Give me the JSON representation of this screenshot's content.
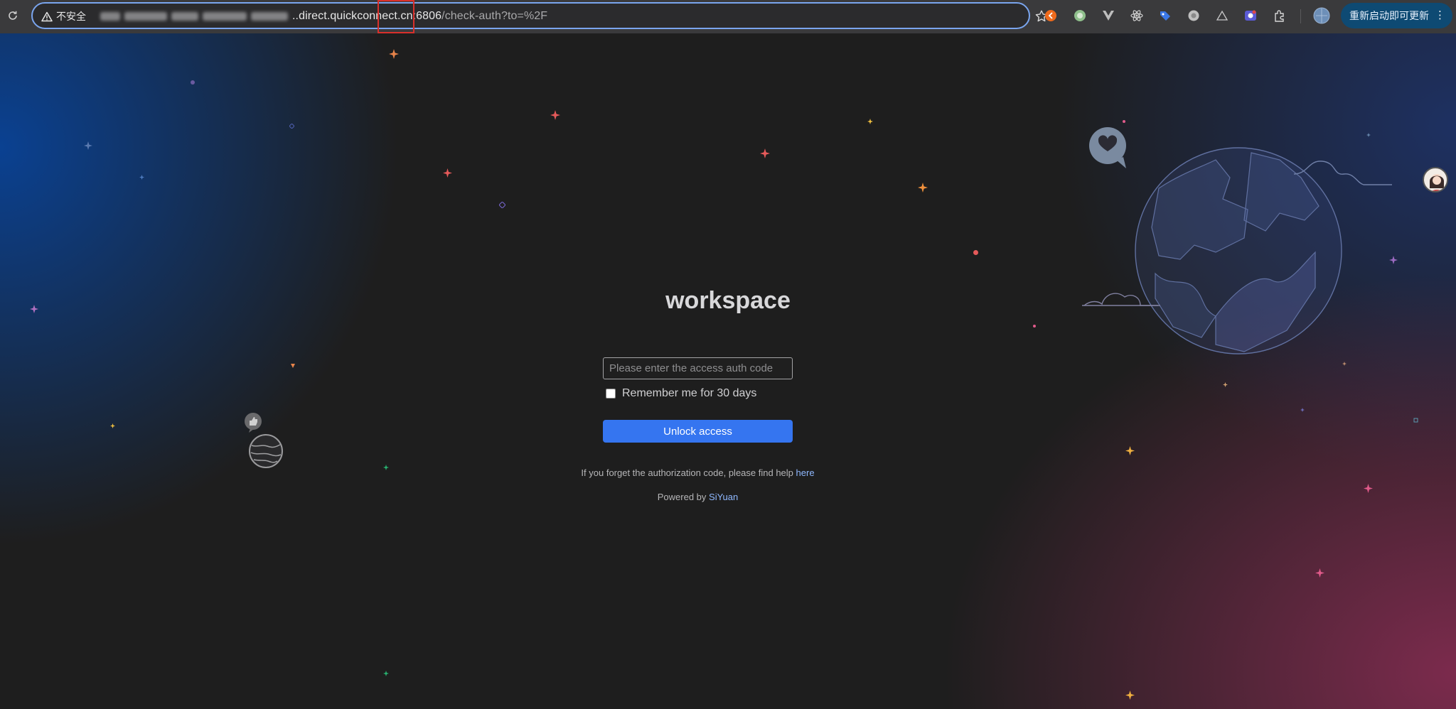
{
  "browser": {
    "security_label": "不安全",
    "url_host_visible": "..direct.quickconnect.cn",
    "url_port": ":6806",
    "url_path": "/check-auth?to=%2F",
    "update_button_label": "重新启动即可更新",
    "icons": [
      "reload-icon",
      "warning-icon",
      "bookmark-star-icon",
      "extension-icon",
      "profile-icon",
      "menu-dots-icon"
    ]
  },
  "login": {
    "title": "workspace",
    "input_placeholder": "Please enter the access auth code",
    "input_value": "",
    "remember_label": "Remember me for 30 days",
    "remember_checked": false,
    "unlock_label": "Unlock access",
    "help_text": "If you forget the authorization code, please find help",
    "help_link": "here",
    "powered_prefix": "Powered by",
    "powered_link": "SiYuan"
  },
  "colors": {
    "accent_button": "#3575f0",
    "link": "#8fb8ff",
    "background": "#1e1e1e",
    "url_highlight": "#d9302b"
  }
}
